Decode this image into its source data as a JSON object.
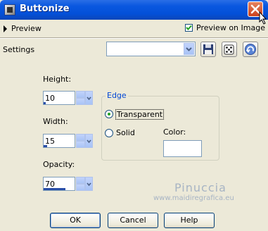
{
  "window": {
    "title": "Buttonize",
    "icons": {
      "app": "buttonize-app-icon",
      "close": "close-icon"
    }
  },
  "preview": {
    "label": "Preview",
    "on_image_label": "Preview on Image",
    "on_image_checked": true
  },
  "settings": {
    "label": "Settings",
    "preset_value": ""
  },
  "fields": {
    "height": {
      "label": "Height:",
      "value": "10"
    },
    "width": {
      "label": "Width:",
      "value": "15"
    },
    "opacity": {
      "label": "Opacity:",
      "value": "70"
    }
  },
  "edge": {
    "title": "Edge",
    "options": [
      "Transparent",
      "Solid"
    ],
    "selected": "Transparent",
    "color_label": "Color:",
    "color_value": "#ffffff"
  },
  "watermark": {
    "name": "Pinuccia",
    "url": "www.maidiregrafica.eu"
  },
  "buttons": {
    "ok": "OK",
    "cancel": "Cancel",
    "help": "Help"
  }
}
